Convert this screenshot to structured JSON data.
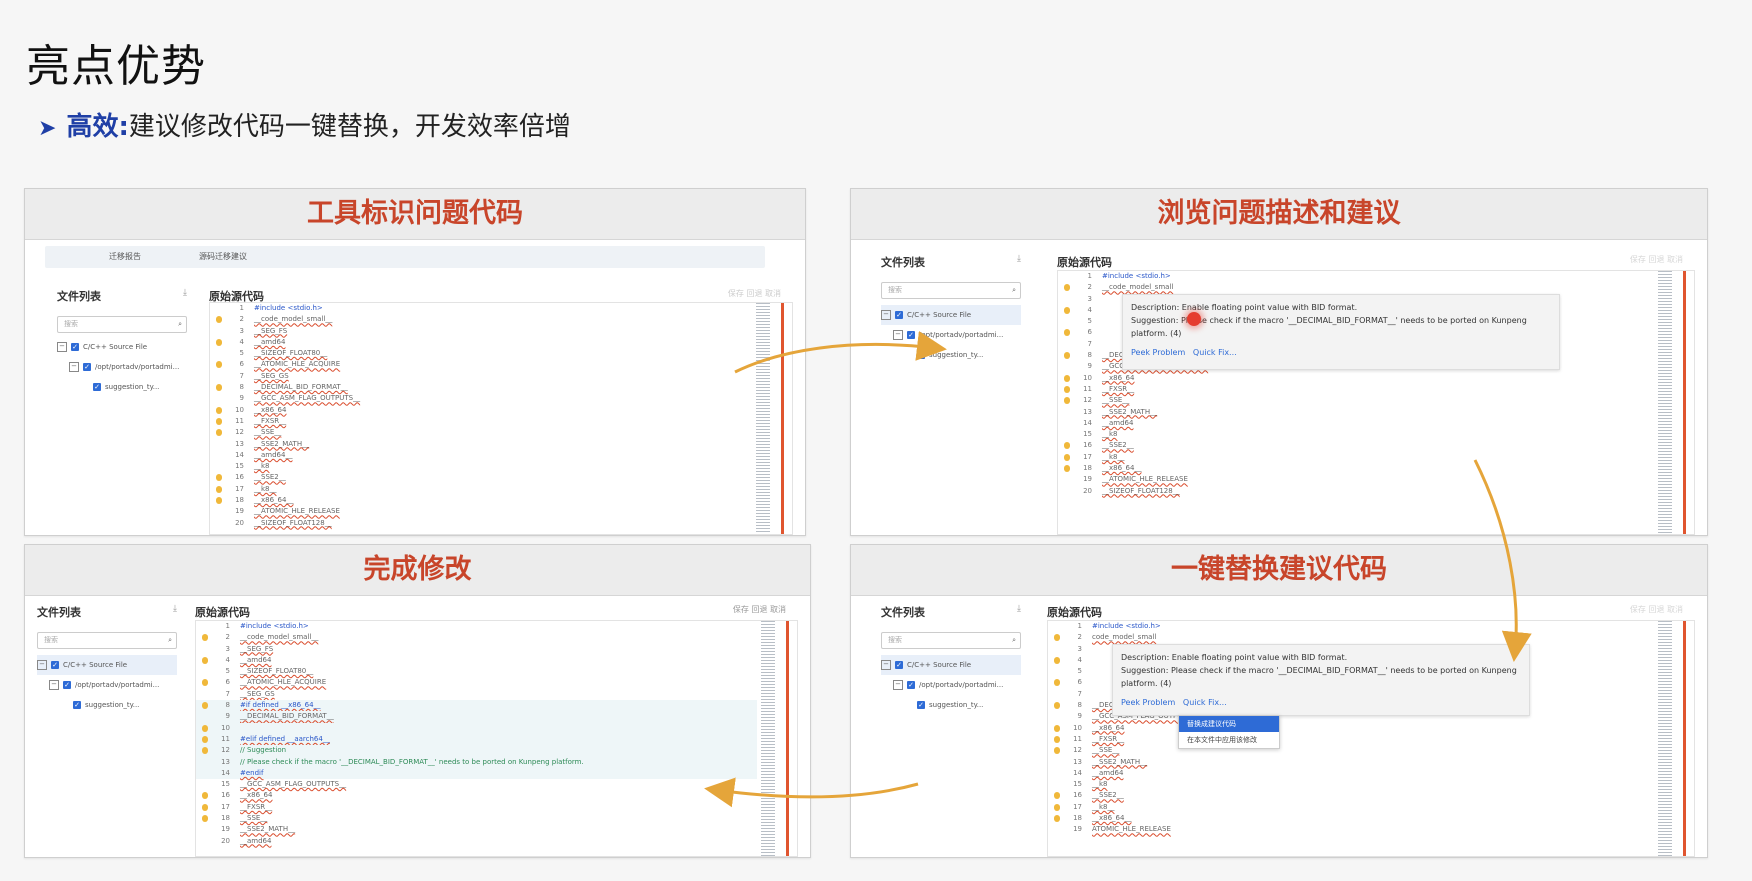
{
  "page": {
    "title": "亮点优势",
    "bullet_key": "高效:",
    "bullet_text": "建议修改代码一键替换，开发效率倍增"
  },
  "colors": {
    "accent_blue": "#1f3fa6",
    "header_red": "#c8452a",
    "arrow_gold": "#e5a53a",
    "error_red": "#e0552f"
  },
  "panels": {
    "p1": {
      "header": "工具标识问题代码",
      "tab1": "迁移报告",
      "tab2": "源码迁移建议"
    },
    "p2": {
      "header": "浏览问题描述和建议"
    },
    "p3": {
      "header": "完成修改"
    },
    "p4": {
      "header": "一键替换建议代码"
    }
  },
  "common": {
    "file_list": "文件列表",
    "source_code": "原始源代码",
    "search_placeholder": "搜索",
    "tree_root": "C/C++ Source File",
    "tree_folder": "/opt/portadv/portadmi...",
    "tree_file": "suggestion_ty...",
    "toolbar": "保存  回退  取消"
  },
  "code_p1": [
    {
      "n": "1",
      "t": "#include <stdio.h>"
    },
    {
      "n": "2",
      "t": "__code_model_small__"
    },
    {
      "n": "3",
      "t": "__SEG_FS"
    },
    {
      "n": "4",
      "t": "__amd64"
    },
    {
      "n": "5",
      "t": "__SIZEOF_FLOAT80__"
    },
    {
      "n": "6",
      "t": "__ATOMIC_HLE_ACQUIRE"
    },
    {
      "n": "7",
      "t": "__SEG_GS"
    },
    {
      "n": "8",
      "t": "__DECIMAL_BID_FORMAT__"
    },
    {
      "n": "9",
      "t": "__GCC_ASM_FLAG_OUTPUTS__"
    },
    {
      "n": "10",
      "t": "__x86_64"
    },
    {
      "n": "11",
      "t": "__FXSR__"
    },
    {
      "n": "12",
      "t": "__SSE__"
    },
    {
      "n": "13",
      "t": "__SSE2_MATH__"
    },
    {
      "n": "14",
      "t": "__amd64__"
    },
    {
      "n": "15",
      "t": "__k8"
    },
    {
      "n": "16",
      "t": "__SSE2__"
    },
    {
      "n": "17",
      "t": "__k8__"
    },
    {
      "n": "18",
      "t": "__x86_64__"
    },
    {
      "n": "19",
      "t": "__ATOMIC_HLE_RELEASE"
    },
    {
      "n": "20",
      "t": "__SIZEOF_FLOAT128__"
    }
  ],
  "code_p2": [
    {
      "n": "1",
      "t": "#include <stdio.h>"
    },
    {
      "n": "2",
      "t": "__code_model_small"
    },
    {
      "n": "3",
      "t": ""
    },
    {
      "n": "4",
      "t": ""
    },
    {
      "n": "5",
      "t": ""
    },
    {
      "n": "6",
      "t": ""
    },
    {
      "n": "7",
      "t": ""
    },
    {
      "n": "8",
      "t": "__DECIMAL_BID_FORMAT__"
    },
    {
      "n": "9",
      "t": "__GCC_ASM_FLAG_OUTPUTS__"
    },
    {
      "n": "10",
      "t": "__x86_64"
    },
    {
      "n": "11",
      "t": "__FXSR__"
    },
    {
      "n": "12",
      "t": "__SSE__"
    },
    {
      "n": "13",
      "t": "__SSE2_MATH__"
    },
    {
      "n": "14",
      "t": "__amd64"
    },
    {
      "n": "15",
      "t": "__k8"
    },
    {
      "n": "16",
      "t": "__SSE2__"
    },
    {
      "n": "17",
      "t": "__k8__"
    },
    {
      "n": "18",
      "t": "__x86_64__"
    },
    {
      "n": "19",
      "t": "__ATOMIC_HLE_RELEASE"
    },
    {
      "n": "20",
      "t": "__SIZEOF_FLOAT128__"
    }
  ],
  "code_p3": [
    {
      "n": "1",
      "t": "#include <stdio.h>"
    },
    {
      "n": "2",
      "t": "__code_model_small__"
    },
    {
      "n": "3",
      "t": "__SEG_FS"
    },
    {
      "n": "4",
      "t": "__amd64"
    },
    {
      "n": "5",
      "t": "__SIZEOF_FLOAT80__"
    },
    {
      "n": "6",
      "t": "__ATOMIC_HLE_ACQUIRE"
    },
    {
      "n": "7",
      "t": "__SEG_GS"
    },
    {
      "n": "8",
      "t": "#if defined __x86_64__"
    },
    {
      "n": "9",
      "t": "    __DECIMAL_BID_FORMAT__"
    },
    {
      "n": "10",
      "t": ""
    },
    {
      "n": "11",
      "t": "#elif defined __aarch64__"
    },
    {
      "n": "12",
      "t": "    // Suggestion"
    },
    {
      "n": "13",
      "t": "    // Please check if the macro '__DECIMAL_BID_FORMAT__' needs to be ported on Kunpeng platform."
    },
    {
      "n": "14",
      "t": "#endif"
    },
    {
      "n": "15",
      "t": "__GCC_ASM_FLAG_OUTPUTS__"
    },
    {
      "n": "16",
      "t": "__x86_64"
    },
    {
      "n": "17",
      "t": "__FXSR__"
    },
    {
      "n": "18",
      "t": "__SSE__"
    },
    {
      "n": "19",
      "t": "__SSE2_MATH__"
    },
    {
      "n": "20",
      "t": "__amd64"
    }
  ],
  "code_p4": [
    {
      "n": "1",
      "t": "#include <stdio.h>"
    },
    {
      "n": "2",
      "t": "code_model_small"
    },
    {
      "n": "3",
      "t": ""
    },
    {
      "n": "4",
      "t": ""
    },
    {
      "n": "5",
      "t": ""
    },
    {
      "n": "6",
      "t": ""
    },
    {
      "n": "7",
      "t": ""
    },
    {
      "n": "8",
      "t": "__DECIMAL_BID_FORMAT__"
    },
    {
      "n": "9",
      "t": "__GCC_ASM_FLAG_OUTPUTS__"
    },
    {
      "n": "10",
      "t": "__x86_64"
    },
    {
      "n": "11",
      "t": "__FXSR__"
    },
    {
      "n": "12",
      "t": "__SSE__"
    },
    {
      "n": "13",
      "t": "__SSE2_MATH__"
    },
    {
      "n": "14",
      "t": "__amd64"
    },
    {
      "n": "15",
      "t": "__k8"
    },
    {
      "n": "16",
      "t": "__SSE2__"
    },
    {
      "n": "17",
      "t": "__k8__"
    },
    {
      "n": "18",
      "t": "__x86_64__"
    },
    {
      "n": "19",
      "t": "ATOMIC_HLE_RELEASE"
    }
  ],
  "popup": {
    "desc": "Description: Enable floating point value with BID format.",
    "sugg": "Suggestion: Please check if the macro '__DECIMAL_BID_FORMAT__' needs to be ported on Kunpeng platform. (4)",
    "peek": "Peek Problem",
    "quick": "Quick Fix..."
  },
  "menu": {
    "item1": "替换成建议代码",
    "item2": "在本文件中应用该修改"
  }
}
